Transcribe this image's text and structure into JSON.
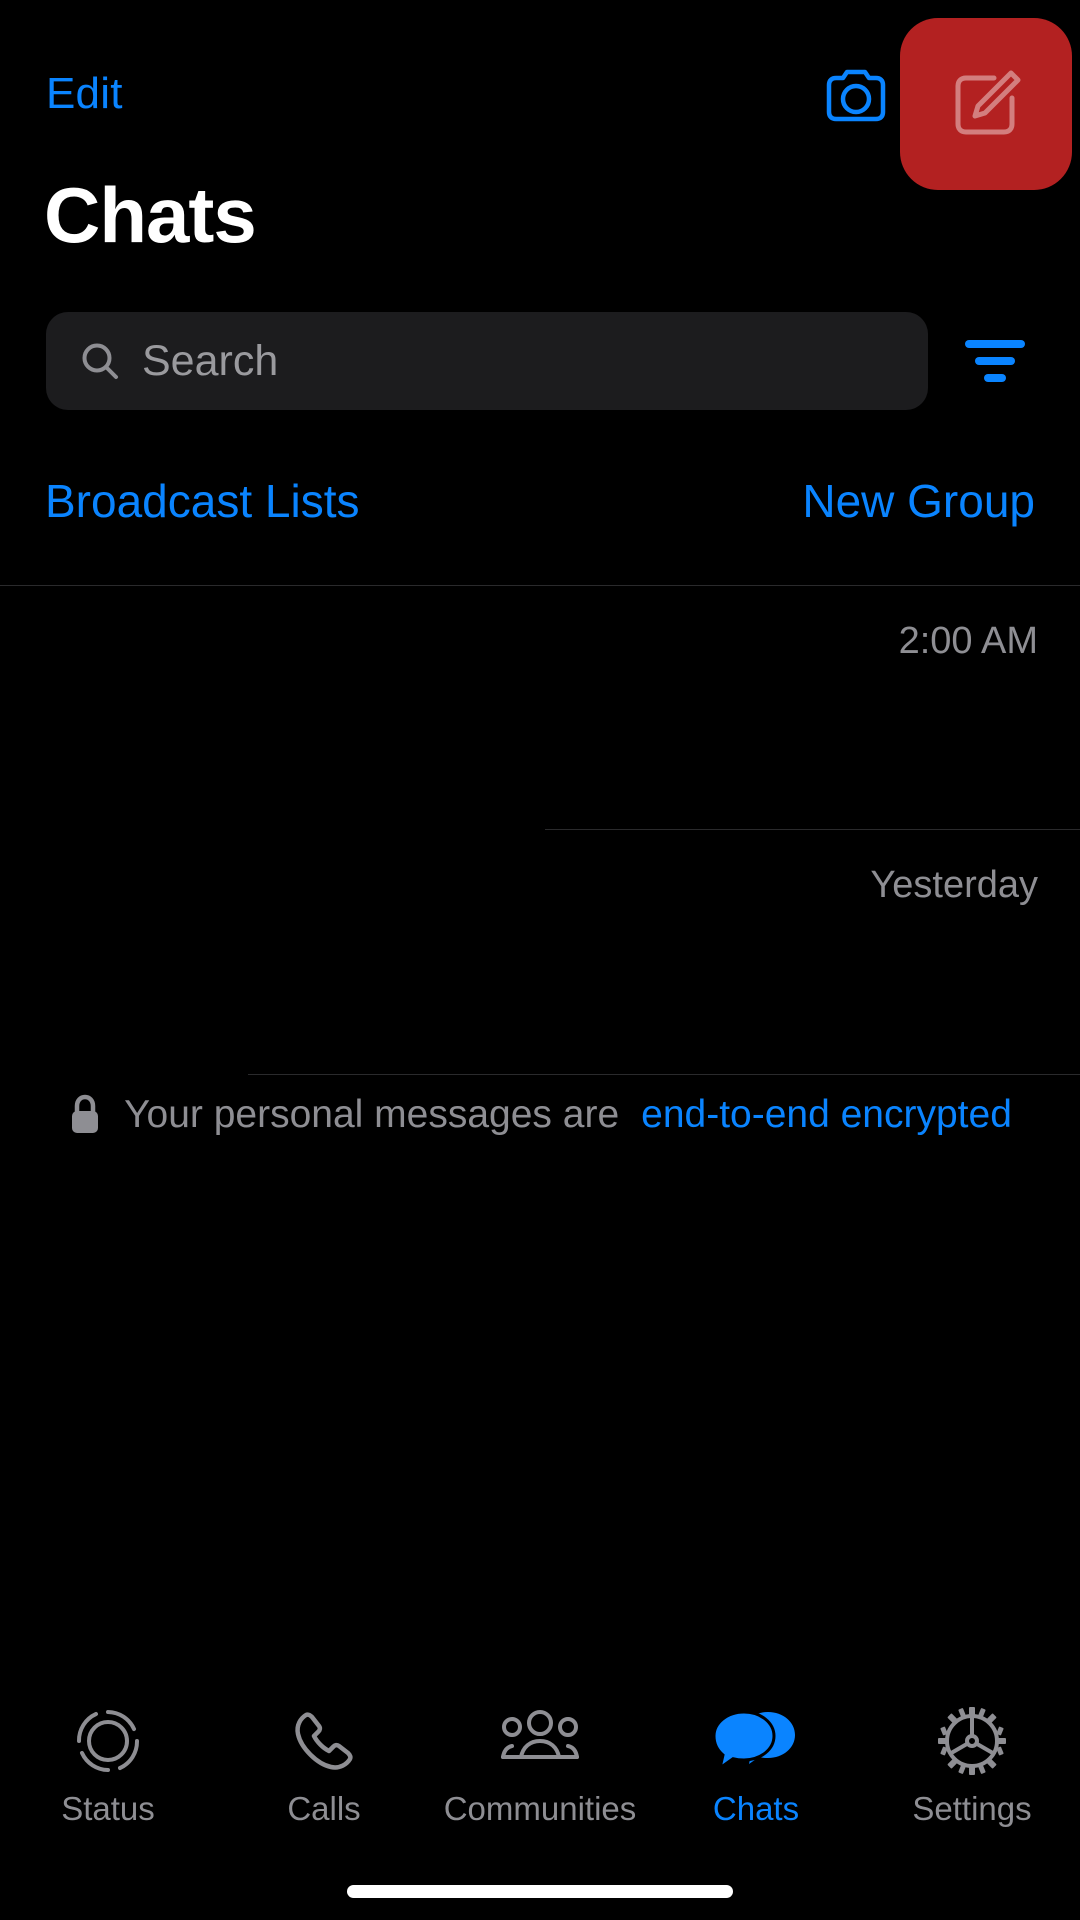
{
  "app": {
    "title": "Chats",
    "accent_blue": "#0a84ff",
    "highlight_red": "#b32121",
    "background": "#000000",
    "secondary_text": "#8e8e93"
  },
  "navbar": {
    "edit_label": "Edit",
    "camera_icon": "camera-icon",
    "compose_icon": "compose-icon"
  },
  "search": {
    "placeholder": "Search",
    "icon": "search-icon",
    "filter_icon": "filter-icon"
  },
  "quick_actions": {
    "broadcast_label": "Broadcast Lists",
    "new_group_label": "New Group"
  },
  "chats": [
    {
      "name": "",
      "preview": "",
      "time": "2:00 AM"
    },
    {
      "name": "",
      "preview": "",
      "time": "Yesterday"
    }
  ],
  "encryption": {
    "icon": "lock-icon",
    "text": "Your personal messages are",
    "link": "end-to-end encrypted"
  },
  "tabbar": {
    "items": [
      {
        "label": "Status",
        "icon": "status-ring-icon",
        "active": false
      },
      {
        "label": "Calls",
        "icon": "phone-icon",
        "active": false
      },
      {
        "label": "Communities",
        "icon": "communities-icon",
        "active": false
      },
      {
        "label": "Chats",
        "icon": "chats-bubble-icon",
        "active": true
      },
      {
        "label": "Settings",
        "icon": "gear-icon",
        "active": false
      }
    ]
  }
}
